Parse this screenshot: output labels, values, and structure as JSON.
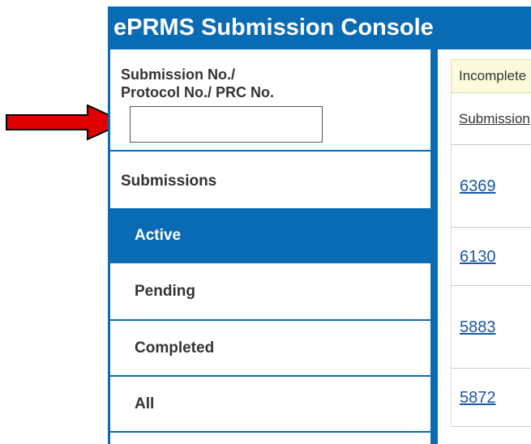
{
  "app": {
    "title": "ePRMS Submission Console"
  },
  "search": {
    "label_line1": "Submission No./",
    "label_line2": "Protocol No./ PRC No.",
    "value": ""
  },
  "nav": {
    "header": "Submissions",
    "items": [
      {
        "label": "Active",
        "active": true
      },
      {
        "label": "Pending",
        "active": false
      },
      {
        "label": "Completed",
        "active": false
      },
      {
        "label": "All",
        "active": false
      }
    ]
  },
  "main": {
    "banner_text": "Incomplete",
    "column_header": "Submission",
    "rows": [
      {
        "submission_no": "6369"
      },
      {
        "submission_no": "6130"
      },
      {
        "submission_no": "5883"
      },
      {
        "submission_no": "5872"
      }
    ]
  },
  "colors": {
    "brand_blue": "#0a6bb5",
    "annotation_red": "#e00000",
    "link_blue": "#1a55a6",
    "banner_bg": "#fdfadb"
  },
  "icons": {
    "annotation": "red-arrow-icon"
  }
}
